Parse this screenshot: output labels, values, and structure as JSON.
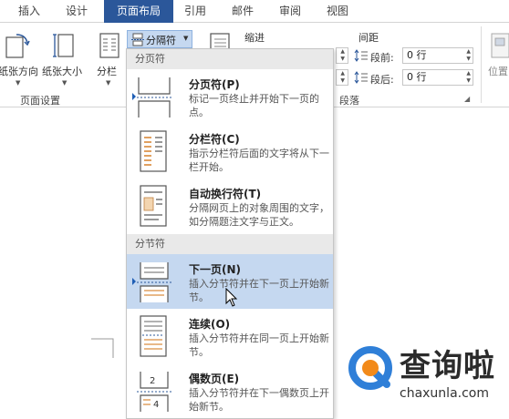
{
  "tabs": [
    "插入",
    "设计",
    "页面布局",
    "引用",
    "邮件",
    "审阅",
    "视图"
  ],
  "active_tab_index": 2,
  "ribbon": {
    "orientation_label": "纸张方向",
    "size_label": "纸张大小",
    "columns_label": "分栏",
    "breaks_label": "分隔符",
    "page_setup_group": "页面设置",
    "indent_label": "缩进",
    "spacing_label": "间距",
    "before_label": "段前:",
    "before_value": "0 行",
    "after_label": "段后:",
    "after_value": "0 行",
    "paragraph_group": "段落",
    "position_label": "位置"
  },
  "menu": {
    "page_breaks_header": "分页符",
    "section_breaks_header": "分节符",
    "items": [
      {
        "title": "分页符(P)",
        "desc": "标记一页终止并开始下一页的点。",
        "icon": "page-break-icon"
      },
      {
        "title": "分栏符(C)",
        "desc": "指示分栏符后面的文字将从下一栏开始。",
        "icon": "column-break-icon"
      },
      {
        "title": "自动换行符(T)",
        "desc": "分隔网页上的对象周围的文字，如分隔题注文字与正文。",
        "icon": "text-wrapping-break-icon"
      },
      {
        "title": "下一页(N)",
        "desc": "插入分节符并在下一页上开始新节。",
        "icon": "next-page-break-icon"
      },
      {
        "title": "连续(O)",
        "desc": "插入分节符并在同一页上开始新节。",
        "icon": "continuous-break-icon"
      },
      {
        "title": "偶数页(E)",
        "desc": "插入分节符并在下一偶数页上开始新节。",
        "icon": "even-page-break-icon"
      }
    ]
  },
  "watermark": {
    "brand": "查询啦",
    "domain": "chaxunla.com"
  },
  "colors": {
    "accent": "#2b579a",
    "highlight": "#c5d8f0",
    "watermark_blue": "#2f7fd8",
    "watermark_orange": "#f28a1a"
  }
}
